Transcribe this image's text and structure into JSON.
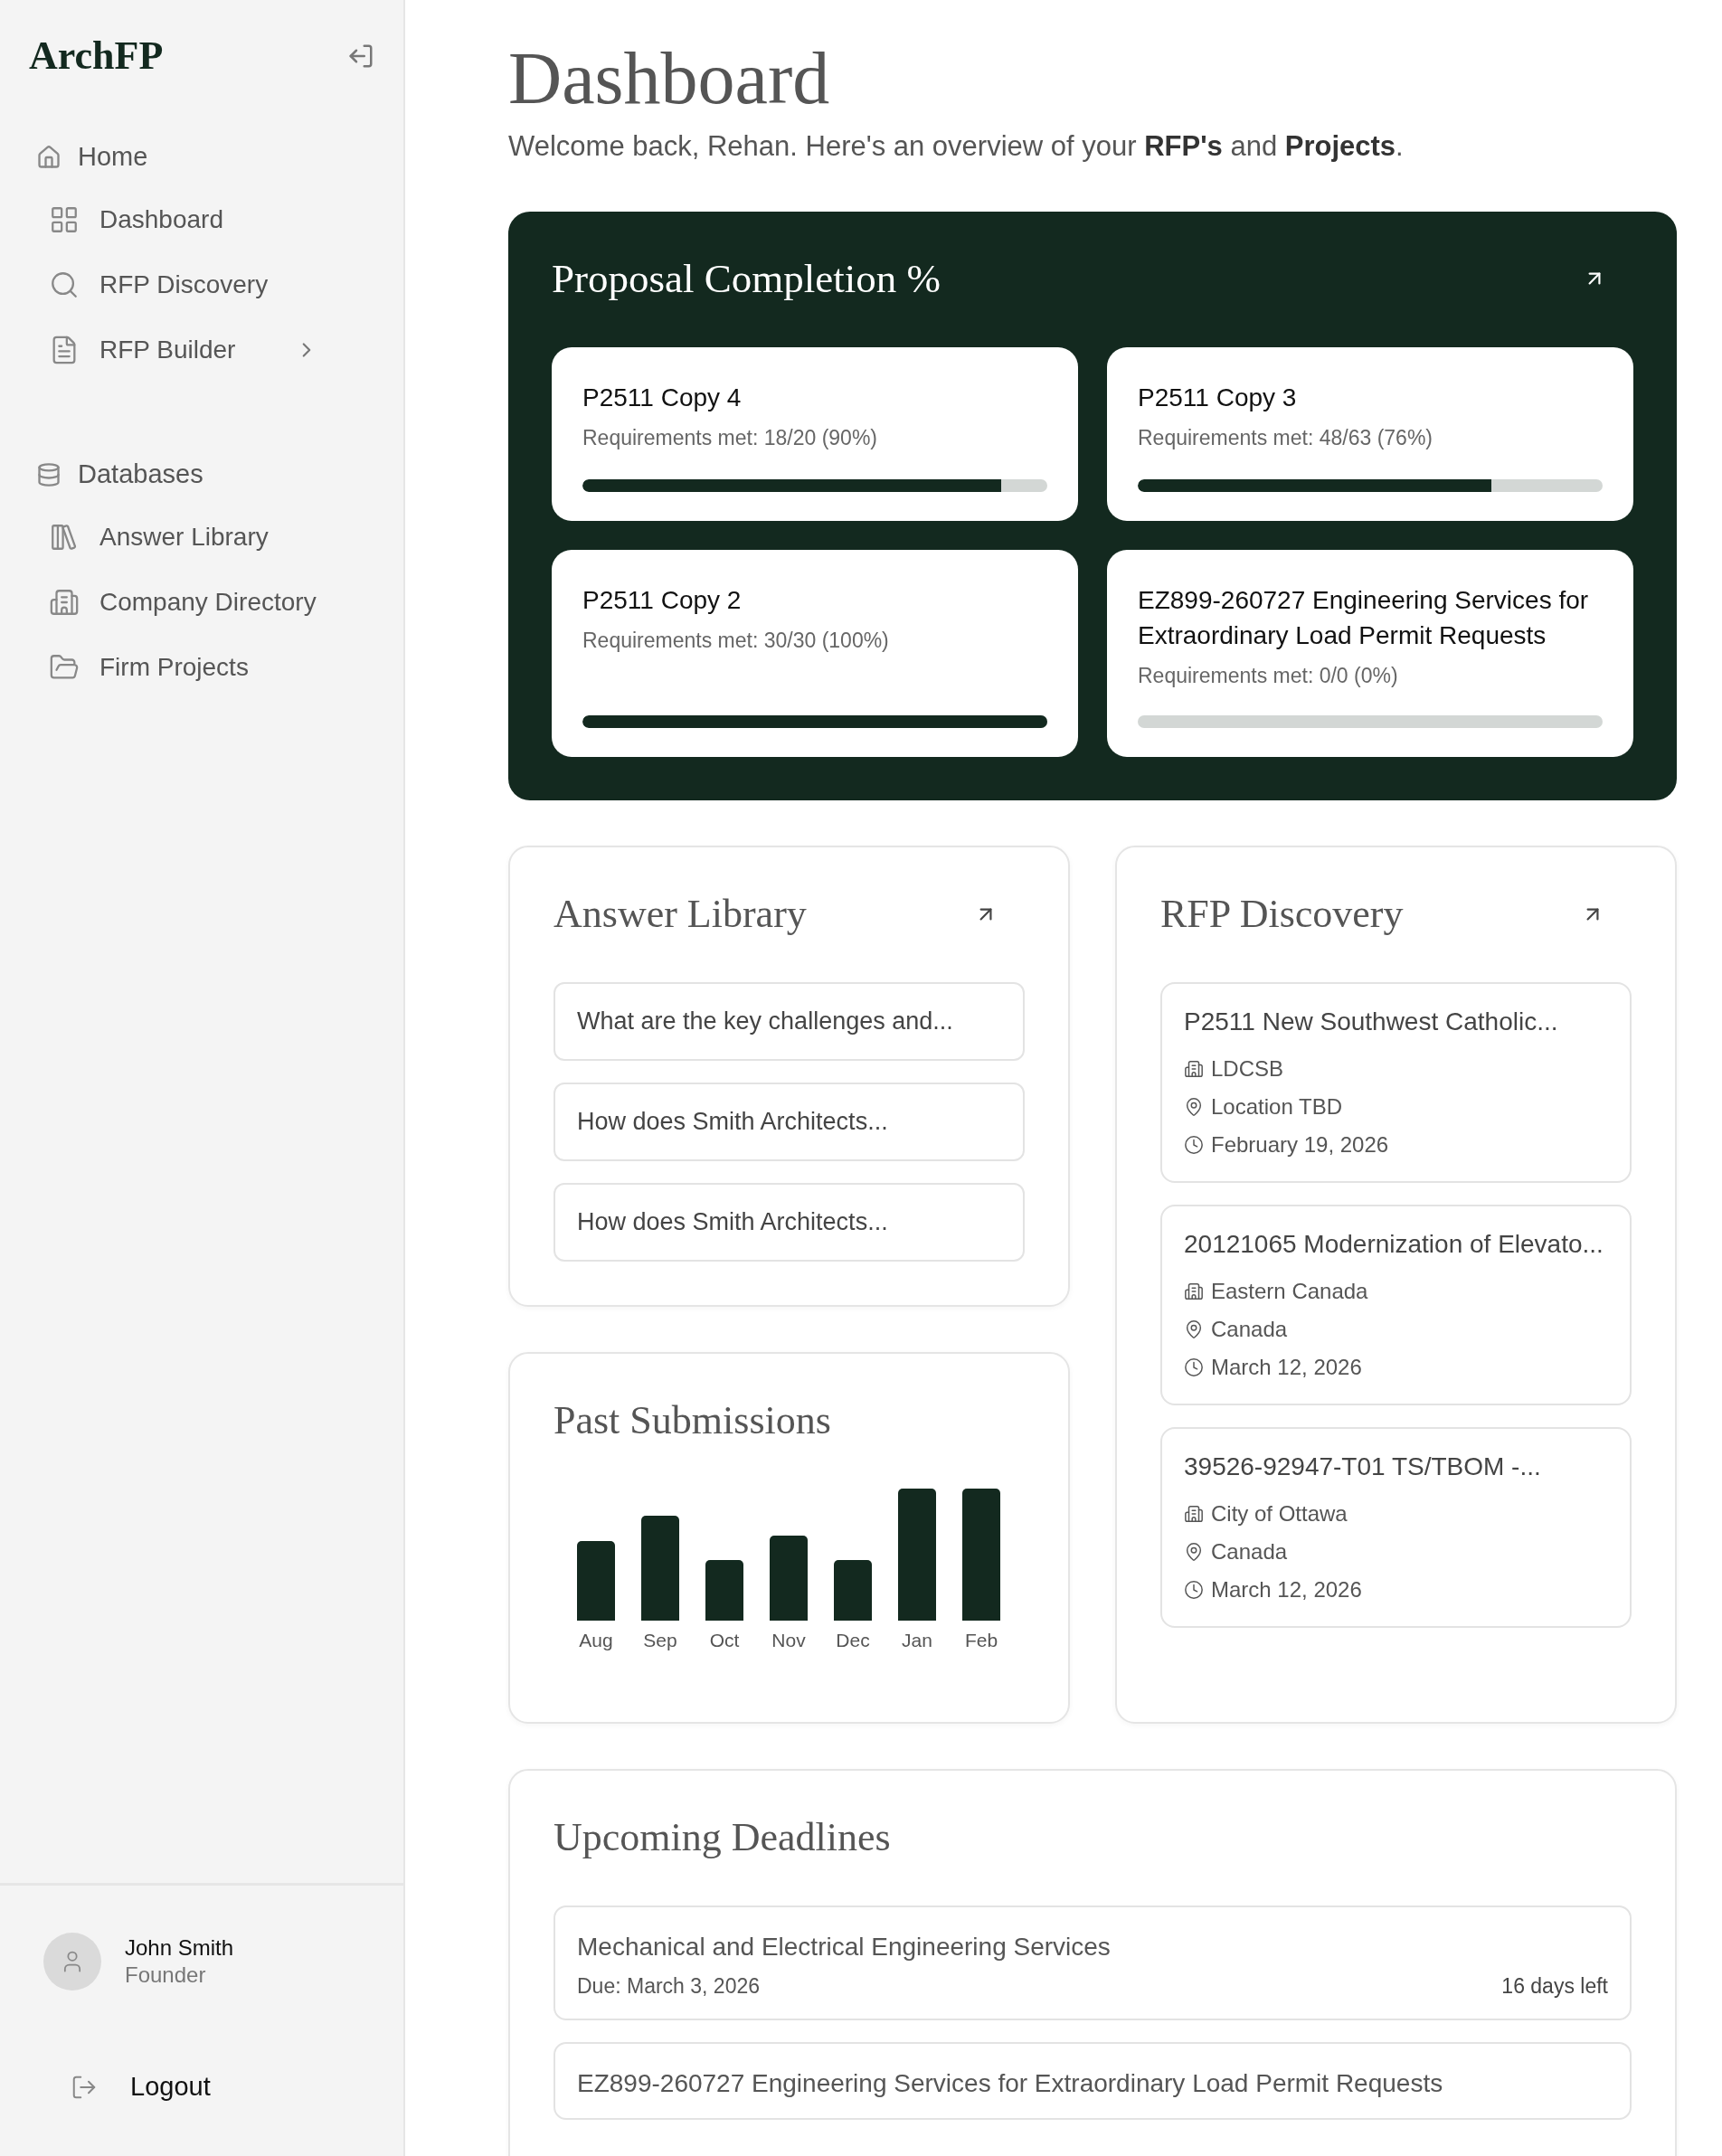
{
  "sidebar": {
    "logo": "ArchFP",
    "sections": [
      {
        "label": "Home",
        "items": [
          {
            "label": "Dashboard",
            "selected": false,
            "has_submenu": false
          },
          {
            "label": "RFP Discovery",
            "selected": false,
            "has_submenu": false
          },
          {
            "label": "RFP Builder",
            "selected": false,
            "has_submenu": true
          }
        ]
      },
      {
        "label": "Databases",
        "items": [
          {
            "label": "Answer Library",
            "selected": false,
            "has_submenu": false
          },
          {
            "label": "Company Directory",
            "selected": false,
            "has_submenu": false
          },
          {
            "label": "Firm Projects",
            "selected": false,
            "has_submenu": false
          }
        ]
      }
    ],
    "user": {
      "name": "John Smith",
      "role": "Founder"
    },
    "logout": "Logout"
  },
  "header": {
    "title": "Dashboard",
    "welcome": "Welcome back, Rehan. Here's an overview of your **RFP's** and **Projects**."
  },
  "proposal_completion": {
    "title": "Proposal Completion %",
    "items": [
      {
        "name": "P2511 Copy 4",
        "requirements": "Requirements met: 18/20 (90%)",
        "level": 0.9
      },
      {
        "name": "P2511 Copy 3",
        "requirements": "Requirements met: 48/63 (76%)",
        "level": 0.76
      },
      {
        "name": "P2511 Copy 2",
        "requirements": "Requirements met: 30/30 (100%)",
        "level": 1
      },
      {
        "name": "EZ899-260727 Engineering Services for Extraordinary Load Permit Requests",
        "requirements": "Requirements met: 0/0 (0%)",
        "level": 0
      }
    ]
  },
  "answer_library": {
    "title": "Answer Library",
    "questions": [
      "What are the key challenges and...",
      "How does Smith  Architects...",
      "How does Smith  Architects..."
    ]
  },
  "rfp_discovery": {
    "title": "RFP Discovery",
    "items": [
      {
        "title": "P2511 New Southwest Catholic...",
        "organization": "LDCSB",
        "location": "Location TBD",
        "date": "February 19, 2026"
      },
      {
        "title": "20121065 Modernization of Elevato...",
        "organization": "Eastern Canada",
        "location": "Canada",
        "date": "March 12, 2026"
      },
      {
        "title": "39526-92947-T01 TS/TBOM -...",
        "organization": "City of Ottawa",
        "location": "Canada",
        "date": "March 12, 2026"
      }
    ]
  },
  "past_submissions": {
    "title": "Past Submissions",
    "months": [
      "Aug",
      "Sep",
      "Oct",
      "Nov",
      "Dec",
      "Jan",
      "Feb"
    ]
  },
  "upcoming_deadlines": {
    "title": "Upcoming Deadlines",
    "items": [
      {
        "title": "Mechanical and Electrical Engineering Services",
        "due": "Due: March 3, 2026",
        "days_left": "16 days left"
      },
      {
        "title": "EZ899-260727 Engineering Services for Extraordinary Load Permit Requests"
      }
    ]
  }
}
